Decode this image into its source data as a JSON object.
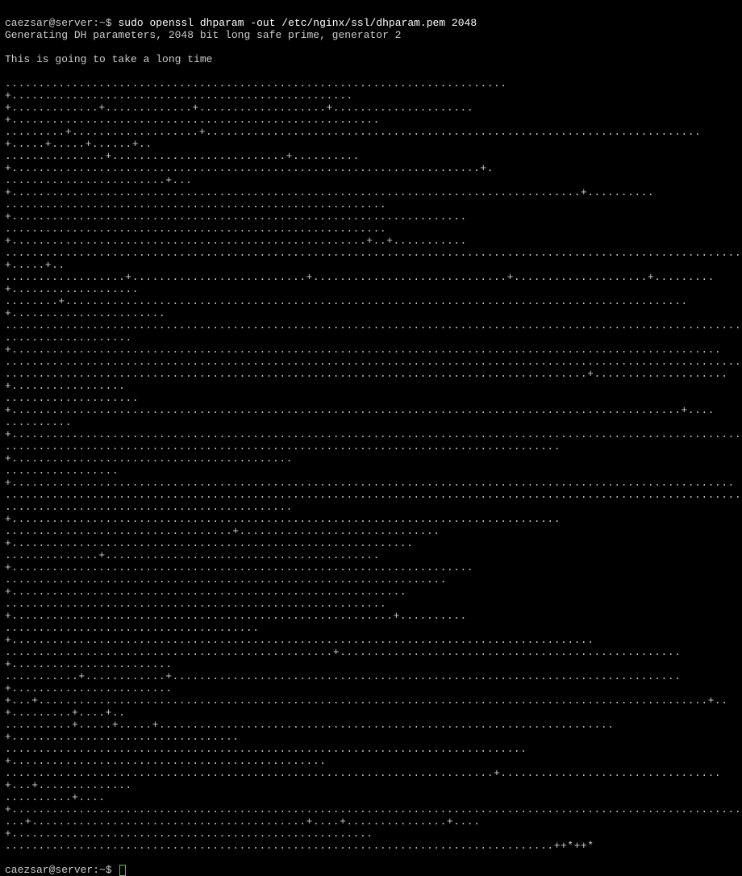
{
  "prompt1": {
    "user_host": "caezsar@server",
    "path": "~",
    "symbol": "$",
    "command": "sudo openssl dhparam -out /etc/nginx/ssl/dhparam.pem 2048"
  },
  "output_lines": [
    "Generating DH parameters, 2048 bit long safe prime, generator 2",
    "This is going to take a long time"
  ],
  "progress_lines": [
    "...........................................................................+...................................................",
    "+.............+.............+...................+.....................+.......................................................",
    ".........+...................+..........................................................................+.....+.....+......+..",
    "...............+..........................+..........+......................................................................+.",
    "........................+...+.....................................................................................+..........",
    ".........................................................+....................................................................",
    ".........................................................+.....................................................+..+...........",
    ".....................................................................................................................+.....+..",
    "..................+..........................+.............................+....................+.........+...................",
    "........+.............................................................................................+.......................",
    "..............................................................................................................................",
    "...................+..........................................................................................................",
    "..............................................................................................................................",
    ".......................................................................................+....................+.................",
    "....................+....................................................................................................+....",
    "..........+...................................................................................................................",
    "...................................................................................+..........................................",
    ".................+............................................................................................................",
    "..............................................................................................................................",
    "...........................................+..................................................................................",
    "..................................+..............................+............................................................",
    "..............+.........................................+.....................................................................",
    "..................................................................+...........................................................",
    ".........................................................+.........................................................+..........",
    "......................................+.......................................................................................",
    ".................................................+...................................................+........................",
    "...........+............+............................................................................+........................",
    "+...+....................................................................................................+..+.........+....+..",
    "..........+.....+.....+....................................................................+..................................",
    "..............................................................................+...............................................",
    ".........................................................................+.................................+...+..............",
    "..........+....+..............................................................................................................",
    "...+.........................................+....+...............+....+......................................................",
    "..................................................................................++*++*"
  ],
  "prompt2": {
    "user_host": "caezsar@server",
    "path": "~",
    "symbol": "$"
  }
}
